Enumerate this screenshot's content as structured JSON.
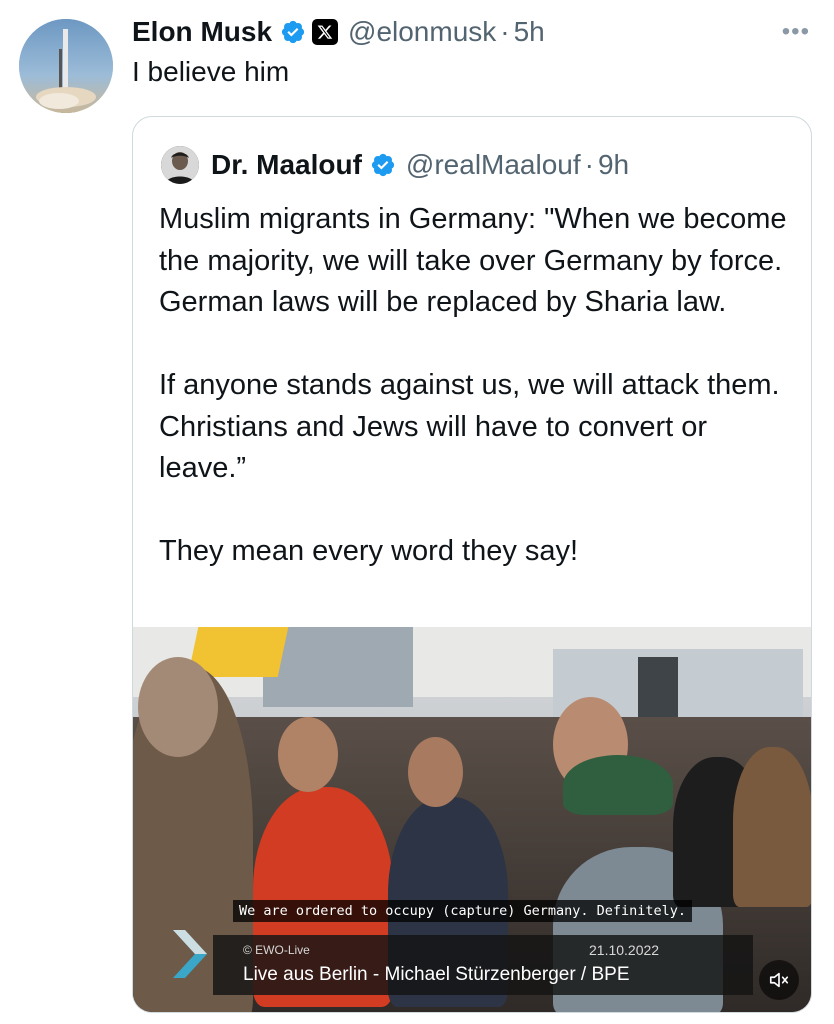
{
  "tweet": {
    "author_name": "Elon Musk",
    "handle": "@elonmusk",
    "separator": "·",
    "time": "5h",
    "text": "I believe him",
    "more_icon": "more-icon",
    "verified_icon": "verified-badge-icon",
    "affiliate_icon": "x-logo-icon"
  },
  "quote": {
    "author_name": "Dr. Maalouf",
    "handle": "@realMaalouf",
    "separator": "·",
    "time": "9h",
    "paragraphs": [
      "Muslim migrants in Germany: \"When we become the majority, we will take over Germany by force. German laws will be replaced by Sharia law.",
      "If anyone stands against us, we will attack them. Christians and Jews will have to convert or leave.”",
      "They mean every word they say!"
    ]
  },
  "video": {
    "subtitle": "We are ordered to occupy (capture) Germany. Definitely.",
    "source": "© EWO-Live",
    "date": "21.10.2022",
    "title": "Live aus Berlin - Michael Stürzenberger /  BPE",
    "mute_icon": "mute-icon"
  },
  "colors": {
    "verified": "#1d9bf0",
    "secondary_text": "#536471",
    "border": "#cfd9de"
  }
}
